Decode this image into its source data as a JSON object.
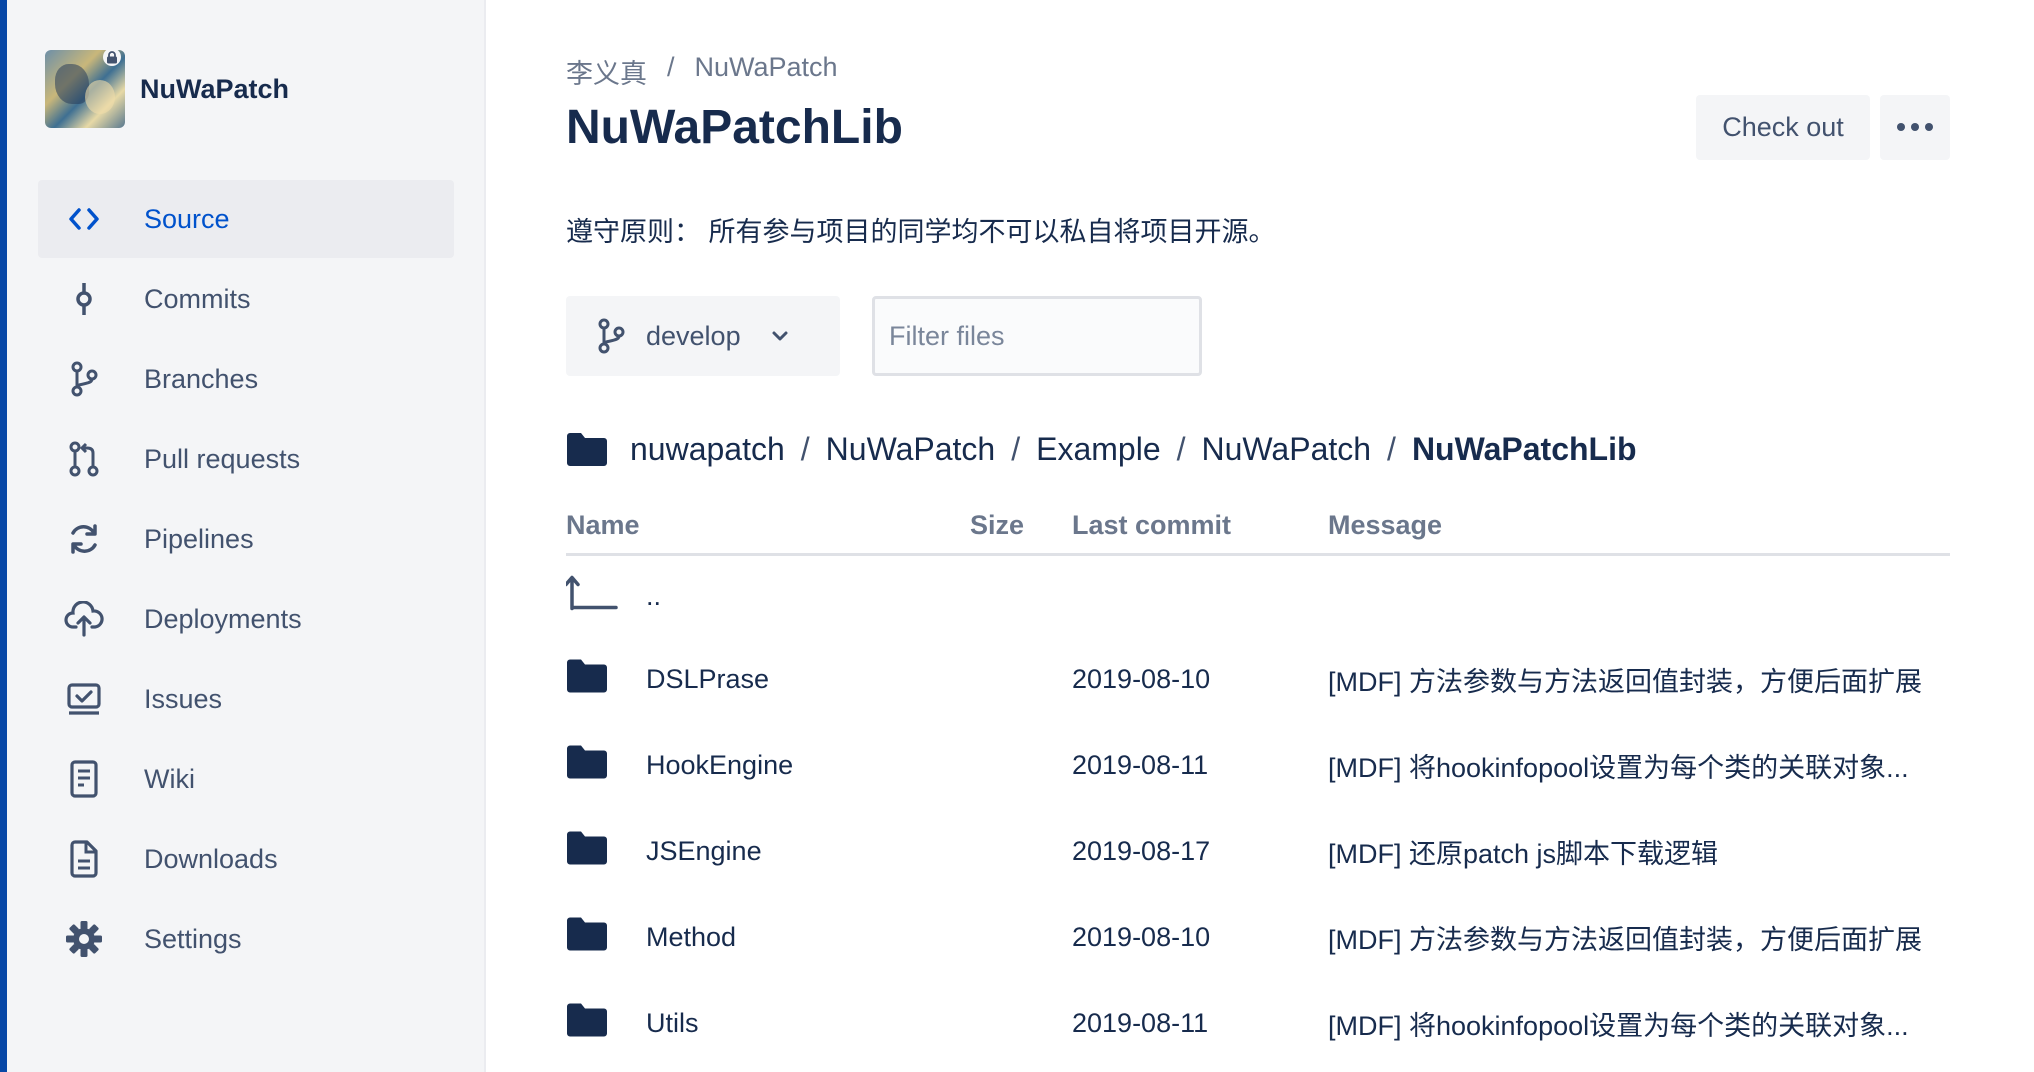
{
  "repo": {
    "name": "NuWaPatch"
  },
  "nav": {
    "items": [
      {
        "label": "Source",
        "icon": "source-code-icon",
        "active": true
      },
      {
        "label": "Commits",
        "icon": "commit-icon"
      },
      {
        "label": "Branches",
        "icon": "branch-icon"
      },
      {
        "label": "Pull requests",
        "icon": "pull-request-icon"
      },
      {
        "label": "Pipelines",
        "icon": "pipelines-icon"
      },
      {
        "label": "Deployments",
        "icon": "cloud-upload-icon"
      },
      {
        "label": "Issues",
        "icon": "issues-icon"
      },
      {
        "label": "Wiki",
        "icon": "wiki-page-icon"
      },
      {
        "label": "Downloads",
        "icon": "download-file-icon"
      },
      {
        "label": "Settings",
        "icon": "gear-icon"
      }
    ]
  },
  "header": {
    "breadcrumb": [
      "李义真",
      "NuWaPatch"
    ],
    "breadcrumb_sep": "/",
    "title": "NuWaPatchLib",
    "checkout_label": "Check out"
  },
  "description": "遵守原则： 所有参与项目的同学均不可以私自将项目开源。",
  "branch": {
    "selected": "develop"
  },
  "filter": {
    "placeholder": "Filter files",
    "value": ""
  },
  "path": {
    "segments": [
      "nuwapatch",
      "NuWaPatch",
      "Example",
      "NuWaPatch"
    ],
    "current": "NuWaPatchLib",
    "sep": "/"
  },
  "table": {
    "columns": {
      "name": "Name",
      "size": "Size",
      "last_commit": "Last commit",
      "message": "Message"
    },
    "parent_label": "..",
    "rows": [
      {
        "name": "DSLPrase",
        "date": "2019-08-10",
        "message": "[MDF] 方法参数与方法返回值封装，方便后面扩展"
      },
      {
        "name": "HookEngine",
        "date": "2019-08-11",
        "message": "[MDF] 将hookinfopool设置为每个类的关联对象..."
      },
      {
        "name": "JSEngine",
        "date": "2019-08-17",
        "message": "[MDF] 还原patch js脚本下载逻辑"
      },
      {
        "name": "Method",
        "date": "2019-08-10",
        "message": "[MDF] 方法参数与方法返回值封装，方便后面扩展"
      },
      {
        "name": "Utils",
        "date": "2019-08-11",
        "message": "[MDF] 将hookinfopool设置为每个类的关联对象..."
      }
    ]
  },
  "colors": {
    "accent": "#0052cc",
    "text": "#172b4d",
    "muted": "#6b778c",
    "sidebar_bg": "#f4f5f7",
    "edge": "#0747a6"
  }
}
